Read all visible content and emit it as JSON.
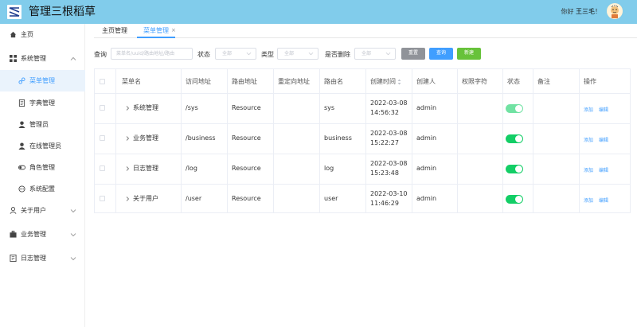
{
  "header": {
    "title": "管理三根稻草",
    "greeting_prefix": "你好",
    "user_name": "王三毛",
    "greeting_suffix": "！",
    "bg_color": "#81cceb"
  },
  "sidebar": {
    "items": [
      {
        "label": "主页",
        "icon": "home-icon"
      },
      {
        "label": "系统管理",
        "icon": "grid-icon",
        "expanded": true
      },
      {
        "label": "菜单管理",
        "icon": "link-icon",
        "active": true
      },
      {
        "label": "字典管理",
        "icon": "document-icon"
      },
      {
        "label": "管理员",
        "icon": "user-icon"
      },
      {
        "label": "在线管理员",
        "icon": "user-icon"
      },
      {
        "label": "角色管理",
        "icon": "toggle-icon"
      },
      {
        "label": "系统配置",
        "icon": "settings-icon"
      },
      {
        "label": "关于用户",
        "icon": "person-icon"
      },
      {
        "label": "业务管理",
        "icon": "briefcase-icon"
      },
      {
        "label": "日志管理",
        "icon": "log-icon"
      }
    ]
  },
  "tabs": [
    {
      "label": "主页管理"
    },
    {
      "label": "菜单管理",
      "active": true,
      "close": "×"
    }
  ],
  "filters": {
    "query_label": "查询",
    "query_placeholder": "菜单名/uuid/路由地址/路由",
    "status_label": "状态",
    "status_value": "全部",
    "type_label": "类型",
    "type_value": "全部",
    "deleted_label": "是否删除",
    "deleted_value": "全部",
    "reset_label": "重置",
    "search_label": "查询",
    "add_label": "新建"
  },
  "table": {
    "columns": [
      "菜单名",
      "访问地址",
      "路由地址",
      "重定向地址",
      "路由名",
      "创建时间",
      "创建人",
      "权限字符",
      "状态",
      "备注",
      "操作"
    ],
    "rows": [
      {
        "name": "系统管理",
        "path": "/sys",
        "component": "Resource",
        "redirect": "",
        "route_name": "sys",
        "date": "2022-03-08",
        "time": "14:56:32",
        "creator": "admin",
        "perm": "",
        "status_on": true,
        "remark": "",
        "op_add": "添加",
        "op_edit": "编辑"
      },
      {
        "name": "业务管理",
        "path": "/business",
        "component": "Resource",
        "redirect": "",
        "route_name": "business",
        "date": "2022-03-08",
        "time": "15:22:27",
        "creator": "admin",
        "perm": "",
        "status_on": true,
        "remark": "",
        "op_add": "添加",
        "op_edit": "编辑"
      },
      {
        "name": "日志管理",
        "path": "/log",
        "component": "Resource",
        "redirect": "",
        "route_name": "log",
        "date": "2022-03-08",
        "time": "15:23:48",
        "creator": "admin",
        "perm": "",
        "status_on": true,
        "remark": "",
        "op_add": "添加",
        "op_edit": "编辑"
      },
      {
        "name": "关于用户",
        "path": "/user",
        "component": "Resource",
        "redirect": "",
        "route_name": "user",
        "date": "2022-03-10",
        "time": "11:46:29",
        "creator": "admin",
        "perm": "",
        "status_on": true,
        "remark": "",
        "op_add": "添加",
        "op_edit": "编辑"
      }
    ]
  },
  "colors": {
    "primary": "#409eff",
    "success": "#67c23a",
    "switch_on": "#13ce66",
    "info": "#909399"
  }
}
